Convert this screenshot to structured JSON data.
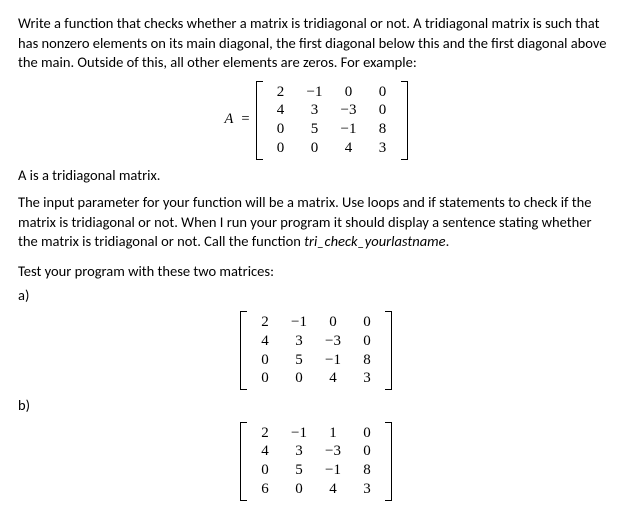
{
  "intro": "Write a function that checks whether a matrix is tridiagonal or not. A tridiagonal matrix is such that has nonzero elements on its main diagonal, the first diagonal below this and the first diagonal above the main. Outside of this, all other elements are zeros. For example:",
  "example": {
    "label": "A",
    "equals": "=",
    "rows": [
      [
        "2",
        "−1",
        "0",
        "0"
      ],
      [
        "4",
        "3",
        "−3",
        "0"
      ],
      [
        "0",
        "5",
        "−1",
        "8"
      ],
      [
        "0",
        "0",
        "4",
        "3"
      ]
    ]
  },
  "statement": "A is a tridiagonal matrix.",
  "body": "The input parameter for your function will be a matrix. Use loops and if statements to check if the matrix is tridiagonal or not. When I run your program it should display a sentence stating whether the matrix is tridiagonal or not. Call the function ",
  "funcname": "tri_check_yourlastname",
  "body_end": ".",
  "test_heading": "Test your program with these two matrices:",
  "parts": {
    "a": {
      "label": "a)",
      "rows": [
        [
          "2",
          "−1",
          "0",
          "0"
        ],
        [
          "4",
          "3",
          "−3",
          "0"
        ],
        [
          "0",
          "5",
          "−1",
          "8"
        ],
        [
          "0",
          "0",
          "4",
          "3"
        ]
      ]
    },
    "b": {
      "label": "b)",
      "rows": [
        [
          "2",
          "−1",
          "1",
          "0"
        ],
        [
          "4",
          "3",
          "−3",
          "0"
        ],
        [
          "0",
          "5",
          "−1",
          "8"
        ],
        [
          "6",
          "0",
          "4",
          "3"
        ]
      ]
    }
  }
}
